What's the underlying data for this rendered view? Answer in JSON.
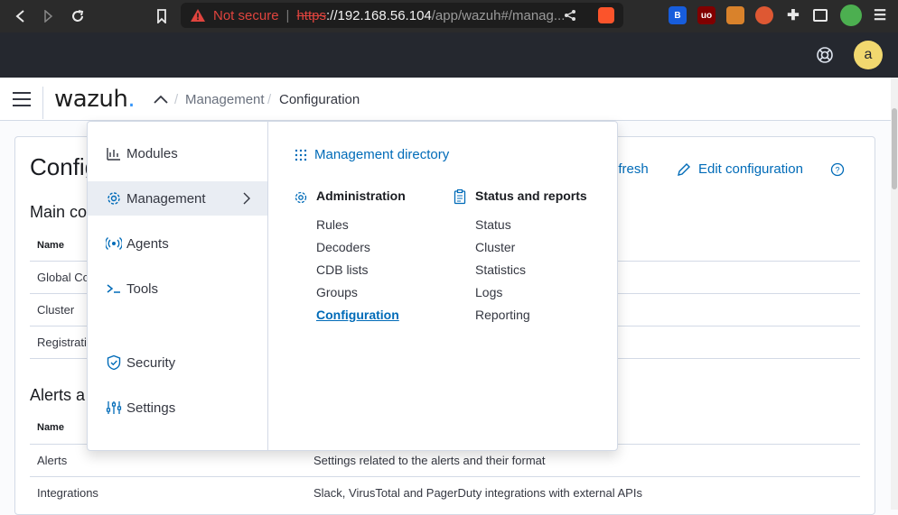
{
  "browser": {
    "url_warning": "Not secure",
    "url_scheme": "https",
    "url_host": "://192.168.56.104",
    "url_path": "/app/wazuh#/manag...",
    "extensions": [
      "bitwarden-icon",
      "ublock-icon",
      "extension-icon-3",
      "duckduckgo-icon",
      "puzzle-icon",
      "sidebar-icon",
      "profile-icon",
      "menu-icon"
    ]
  },
  "header": {
    "avatar_initial": "a"
  },
  "nav": {
    "logo": "wazuh",
    "logo_dot": ".",
    "breadcrumb_sep": "/",
    "breadcrumbs": [
      "Management",
      "Configuration"
    ]
  },
  "page": {
    "title": "Config",
    "refresh_label": "efresh",
    "edit_label": "Edit configuration",
    "section_main": "Main co",
    "section_alerts": "Alerts a",
    "col_name": "Name",
    "main_rows": [
      "Global Co",
      "Cluster",
      "Registrati"
    ],
    "alert_rows": [
      {
        "name": "Alerts",
        "desc": "Settings related to the alerts and their format"
      },
      {
        "name": "Integrations",
        "desc": "Slack, VirusTotal and PagerDuty integrations with external APIs"
      }
    ]
  },
  "menu": {
    "left_items": [
      {
        "label": "Modules",
        "icon": "modules-icon"
      },
      {
        "label": "Management",
        "icon": "gear-icon"
      },
      {
        "label": "Agents",
        "icon": "agents-icon"
      },
      {
        "label": "Tools",
        "icon": "terminal-icon"
      },
      {
        "label": "Security",
        "icon": "shield-icon"
      },
      {
        "label": "Settings",
        "icon": "sliders-icon"
      }
    ],
    "directory_link": "Management directory",
    "administration": {
      "title": "Administration",
      "items": [
        "Rules",
        "Decoders",
        "CDB lists",
        "Groups",
        "Configuration"
      ]
    },
    "status_reports": {
      "title": "Status and reports",
      "items": [
        "Status",
        "Cluster",
        "Statistics",
        "Logs",
        "Reporting"
      ]
    }
  },
  "colors": {
    "link": "#006bb8",
    "header_bg": "#25282f",
    "avatar_bg": "#f1d86f",
    "logo_dot": "#3595f9"
  }
}
